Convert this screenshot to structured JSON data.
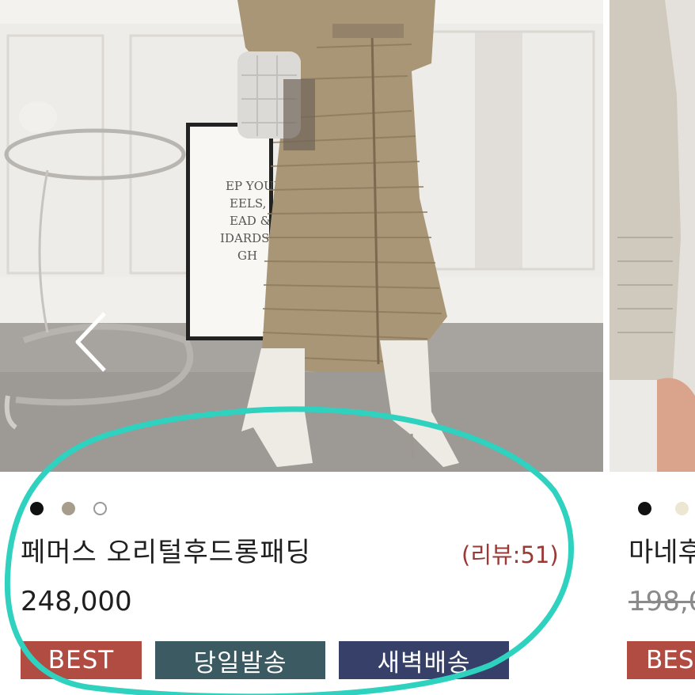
{
  "main_product": {
    "name": "페머스 오리털후드롱패딩",
    "review": "(리뷰:51",
    "review_suffix": ")",
    "price": "248,000",
    "badges": [
      "BEST",
      "당일발송",
      "새벽배송"
    ],
    "swatch_colors": [
      "#111111",
      "#a79d8c",
      "#ffffff"
    ],
    "poster_text": [
      "EP YOUR",
      "EELS,",
      "EAD &",
      "IDARDS",
      "GH"
    ]
  },
  "side_product": {
    "name": "마네후",
    "price": "198,0",
    "badge": "BES",
    "swatch_colors": [
      "#111111",
      "#ece6d2"
    ]
  },
  "colors": {
    "highlight_circle": "#2fd1bf",
    "best_badge": "#b14c43",
    "same_day_badge": "#3c5a62",
    "dawn_badge": "#374068",
    "review_text": "#9a3a36"
  },
  "icons": {
    "prev": "chevron-left-icon"
  }
}
